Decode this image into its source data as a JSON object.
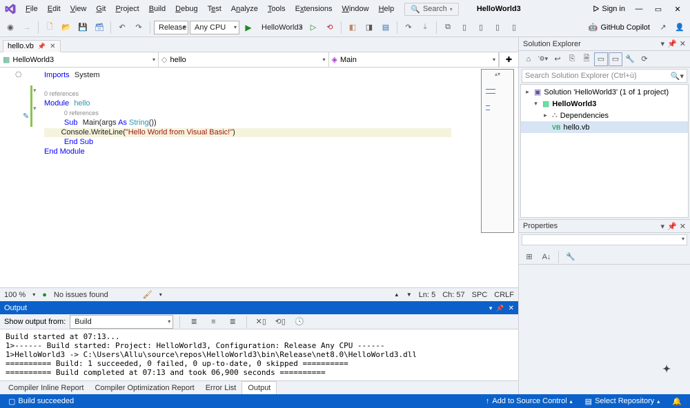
{
  "menubar": {
    "items": [
      "File",
      "Edit",
      "View",
      "Git",
      "Project",
      "Build",
      "Debug",
      "Test",
      "Analyze",
      "Tools",
      "Extensions",
      "Window",
      "Help"
    ],
    "search_label": "Search",
    "solution_name": "HelloWorld3",
    "signin": "Sign in",
    "copilot": "GitHub Copilot"
  },
  "toolbar": {
    "config": "Release",
    "platform": "Any CPU",
    "start_target": "HelloWorld3"
  },
  "doc_tab": {
    "name": "hello.vb"
  },
  "navbar": {
    "project": "HelloWorld3",
    "class": "hello",
    "member": "Main"
  },
  "code": {
    "import_kw": "Imports",
    "import_ns": "System",
    "codelens": "0 references",
    "module_kw": "Module",
    "module_name": "hello",
    "sub_kw": "Sub",
    "main_sig": "Main(args ",
    "as_kw": "As",
    "string_t": " String",
    "paren_close": "())",
    "console_t": "Console",
    "wl": ".WriteLine(",
    "str": "\"Hello World from Visual Basic!\"",
    "close_paren": ")",
    "end_sub": "End Sub",
    "end_module": "End Module"
  },
  "editor_status": {
    "zoom": "100 %",
    "issues": "No issues found",
    "ln": "Ln: 5",
    "ch": "Ch: 57",
    "spc": "SPC",
    "crlf": "CRLF"
  },
  "output": {
    "title": "Output",
    "show_from_label": "Show output from:",
    "show_from_value": "Build",
    "text": "Build started at 07:13...\n1>------ Build started: Project: HelloWorld3, Configuration: Release Any CPU ------\n1>HelloWorld3 -> C:\\Users\\Allu\\source\\repos\\HelloWorld3\\bin\\Release\\net8.0\\HelloWorld3.dll\n========== Build: 1 succeeded, 0 failed, 0 up-to-date, 0 skipped ==========\n========== Build completed at 07:13 and took 06,900 seconds =========="
  },
  "bottom_tabs": [
    "Compiler Inline Report",
    "Compiler Optimization Report",
    "Error List",
    "Output"
  ],
  "solution_explorer": {
    "title": "Solution Explorer",
    "search_placeholder": "Search Solution Explorer (Ctrl+ù)",
    "root": "Solution 'HelloWorld3' (1 of 1 project)",
    "project": "HelloWorld3",
    "deps": "Dependencies",
    "file": "hello.vb",
    "file_prefix": "VB"
  },
  "properties": {
    "title": "Properties"
  },
  "statusbar": {
    "build": "Build succeeded",
    "add_sc": "Add to Source Control",
    "sel_repo": "Select Repository"
  }
}
